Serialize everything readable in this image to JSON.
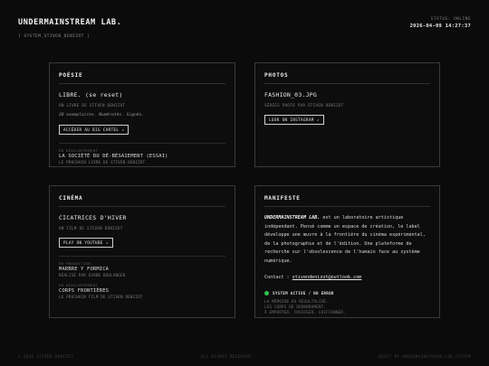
{
  "header": {
    "title": "UNDERMAINSTREAM LAB.",
    "subtitle": "[ SYSTEM_STIVEN_DENIZOT ]",
    "status_label": "STATUS: ONLINE",
    "datetime": "2026-04-09 14:27:37"
  },
  "poesie": {
    "heading": "POÉSIE",
    "title": "LIBRE. (se reset)",
    "sub": "UN LIVRE DE STIVEN DENIZOT",
    "italic": "20 exemplaires. Numérotés. Signés.",
    "button": "ACCÉDER AU BIG CARTEL ↗",
    "dev_label": "EN DÉVELOPPEMENT",
    "dev_name": "LA SOCIÉTÉ DU DÉ-BÉSAIEMENT (ESSAI)",
    "dev_desc": "LE PROCHAIN LIVRE DE STIVEN DENIZOT"
  },
  "photos": {
    "heading": "PHOTOS",
    "title": "FASHION_03.JPG",
    "sub": "SÉRIES PHOTO PAR STIVEN DENIZOT",
    "button": "LOOK ON INSTAGRAM ↗"
  },
  "cinema": {
    "heading": "CINÉMA",
    "title": "CICATRICES D'HIVER",
    "sub": "UN FILM DE STIVEN DENIZOT",
    "button": "PLAY ON YOUTUBE ↗",
    "prod_label": "EN PRODUCTION",
    "prod_name": "MARBRE Y FORMICA",
    "prod_desc": "RÉALISÉ PAR EVANE BOULANGER",
    "dev_label": "EN DÉVELOPPEMENT",
    "dev_name": "CORPS FRONTIÈRES",
    "dev_desc": "LE PROCHAIN FILM DE STIVEN DENIZOT"
  },
  "manifeste": {
    "heading": "MANIFESTE",
    "brand": "UNDERMAINSTREAM LAB.",
    "text": " est un laboratoire artistique indépendant. Pensé comme un espace de création, le label développe une œuvre à la frontière du cinéma expérimental, de la photographie et de l'édition. Une plateforme de recherche sur l'obsolescence de l'humain face au système numérique.",
    "contact_label": "Contact : ",
    "contact_email": "stivendenizot@outlook.com",
    "status_label": "SYSTEM ACTIVE / NO ERROR",
    "status_line1": "LA MÉMOIRE DU RÉSULTALISÉ.",
    "status_line2": "LES CORPS DE DEMARRAMENT.",
    "status_line3": "À EMPORTER, FROISSER, CHIFFONNER.",
    "status_color": "#33c24d"
  },
  "footer": {
    "left": "© 2026 STIVEN DENIZOT",
    "center": "ALL RIGHTS RESERVED",
    "right": "BUILT BY UNDERMAINSTREAM_LAB_SYSTEM"
  }
}
